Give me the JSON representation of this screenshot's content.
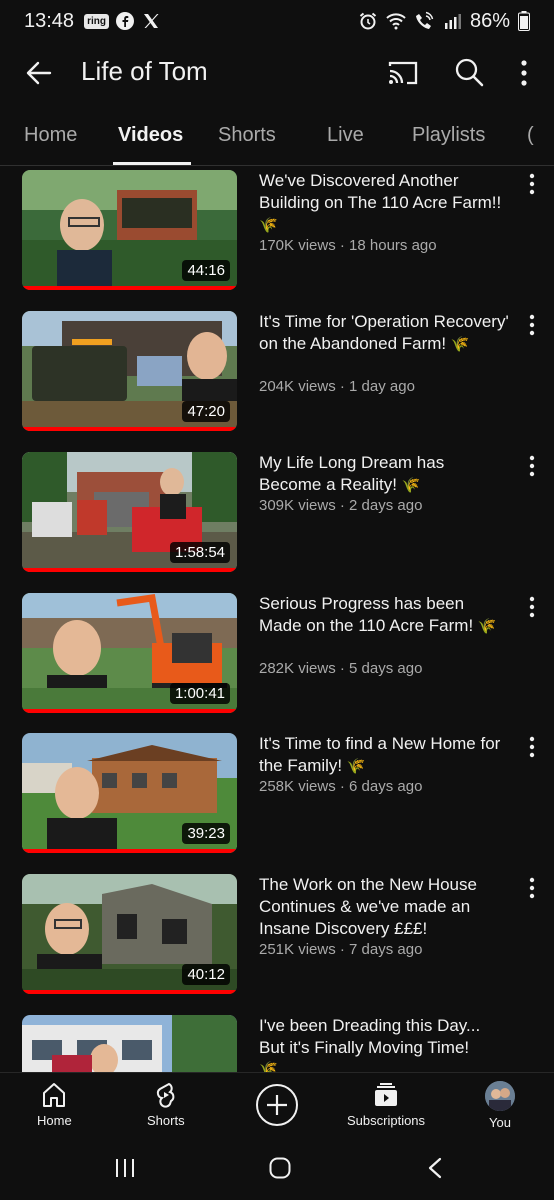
{
  "status_bar": {
    "time": "13:48",
    "ring_label": "ring",
    "battery": "86%"
  },
  "header": {
    "title": "Life of Tom",
    "icons": [
      "back-arrow-icon",
      "cast-icon",
      "search-icon",
      "more-vert-icon"
    ]
  },
  "tabs": [
    {
      "label": "Home"
    },
    {
      "label": "Videos",
      "active": true
    },
    {
      "label": "Shorts"
    },
    {
      "label": "Live"
    },
    {
      "label": "Playlists"
    }
  ],
  "videos": [
    {
      "title": "We've Discovered Another Building on The 110 Acre Farm!!",
      "meta": "170K views · 18 hours ago",
      "duration": "44:16"
    },
    {
      "title": "It's Time for 'Operation Recovery' on the Abandoned Farm!",
      "meta": "204K views · 1 day ago",
      "duration": "47:20"
    },
    {
      "title": "My Life Long Dream has Become a Reality!",
      "meta": "309K views · 2 days ago",
      "duration": "1:58:54"
    },
    {
      "title": "Serious Progress has been Made on the 110 Acre Farm!",
      "meta": "282K views · 5 days ago",
      "duration": "1:00:41"
    },
    {
      "title": "It's Time to find a New Home for the Family!",
      "meta": "258K views · 6 days ago",
      "duration": "39:23"
    },
    {
      "title": "The Work on the New House Continues & we've made an Insane Discovery £££!",
      "meta": "251K views · 7 days ago",
      "duration": "40:12"
    },
    {
      "title": "I've been Dreading this Day... But it's Finally Moving Time!",
      "meta": "",
      "duration": ""
    }
  ],
  "bottom_nav": [
    {
      "label": "Home"
    },
    {
      "label": "Shorts"
    },
    {
      "label": "Subscriptions"
    },
    {
      "label": "You"
    }
  ],
  "colors": {
    "background": "#0f0f0f",
    "text": "#f1f1f1",
    "secondary": "#aaaaaa",
    "accent": "#ff0000",
    "emoji": "#e5b23a"
  }
}
